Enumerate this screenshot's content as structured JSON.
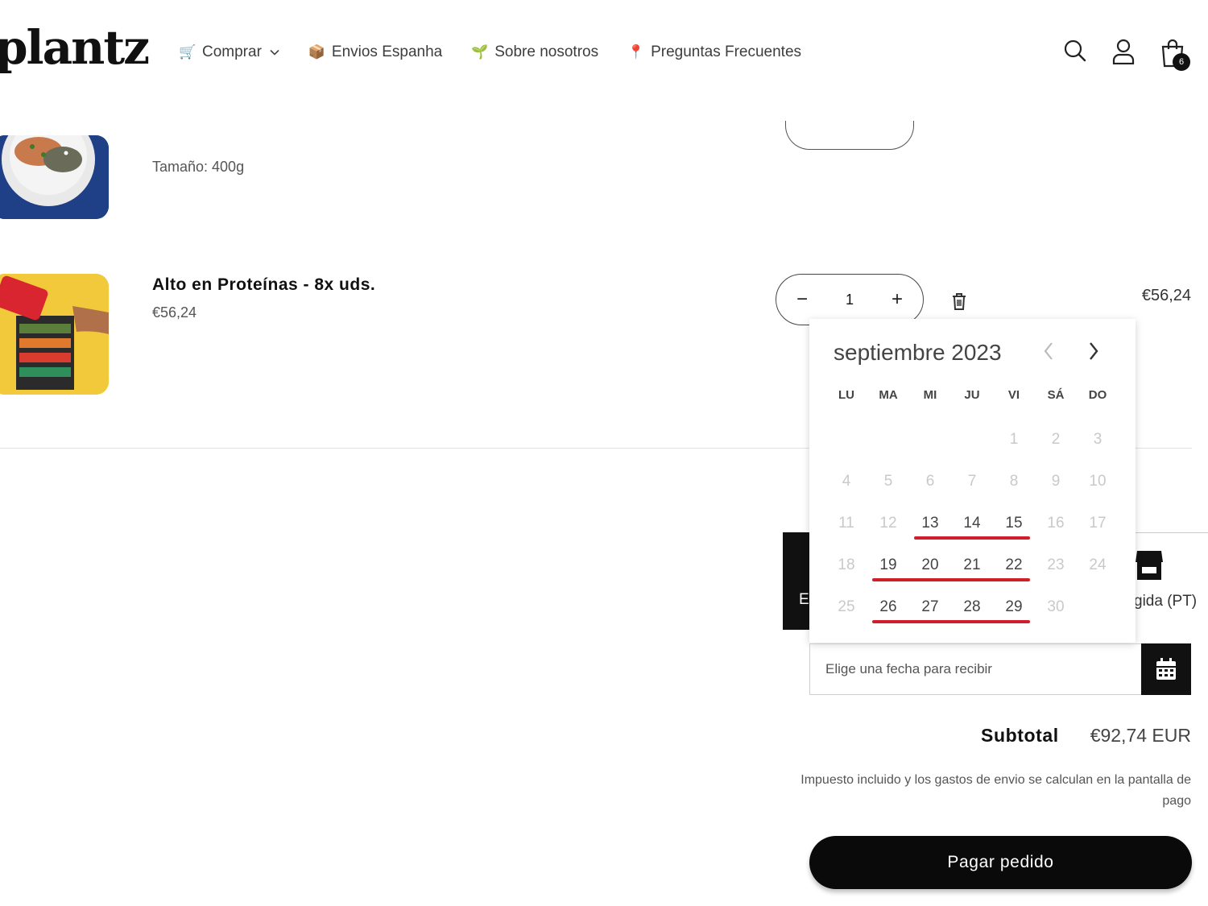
{
  "brand": {
    "logo": "plantz"
  },
  "nav": {
    "items": [
      {
        "label": "Comprar",
        "icon": "shopping-cart-icon",
        "has_dropdown": true
      },
      {
        "label": "Envios Espanha",
        "icon": "package-icon"
      },
      {
        "label": "Sobre nosotros",
        "icon": "seedling-icon"
      },
      {
        "label": "Preguntas Frecuentes",
        "icon": "pin-icon"
      }
    ]
  },
  "header": {
    "cart_count": "6"
  },
  "cart": {
    "items": [
      {
        "size_text": "Tamaño: 400g"
      },
      {
        "name": "Alto en Proteínas - 8x uds.",
        "unit_price": "€56,24",
        "quantity": "1",
        "line_total": "€56,24"
      }
    ]
  },
  "delivery_options": {
    "left_label": "E",
    "right_label": "gida (PT)"
  },
  "calendar": {
    "month_title": "septiembre 2023",
    "weekdays": [
      "LU",
      "MA",
      "MI",
      "JU",
      "VI",
      "SÁ",
      "DO"
    ],
    "first_weekday_index": 4,
    "days_in_month": 30,
    "available_days": [
      13,
      14,
      15,
      19,
      20,
      21,
      22,
      26,
      27,
      28,
      29
    ],
    "highlight_color": "#d01f2a"
  },
  "date_input": {
    "placeholder": "Elige una fecha para recibir",
    "icon": "calendar-icon"
  },
  "summary": {
    "subtotal_label": "Subtotal",
    "subtotal_value": "€92,74 EUR",
    "tax_note": "Impuesto incluido y los gastos de envio se calculan en la pantalla de pago",
    "checkout_label": "Pagar pedido"
  }
}
